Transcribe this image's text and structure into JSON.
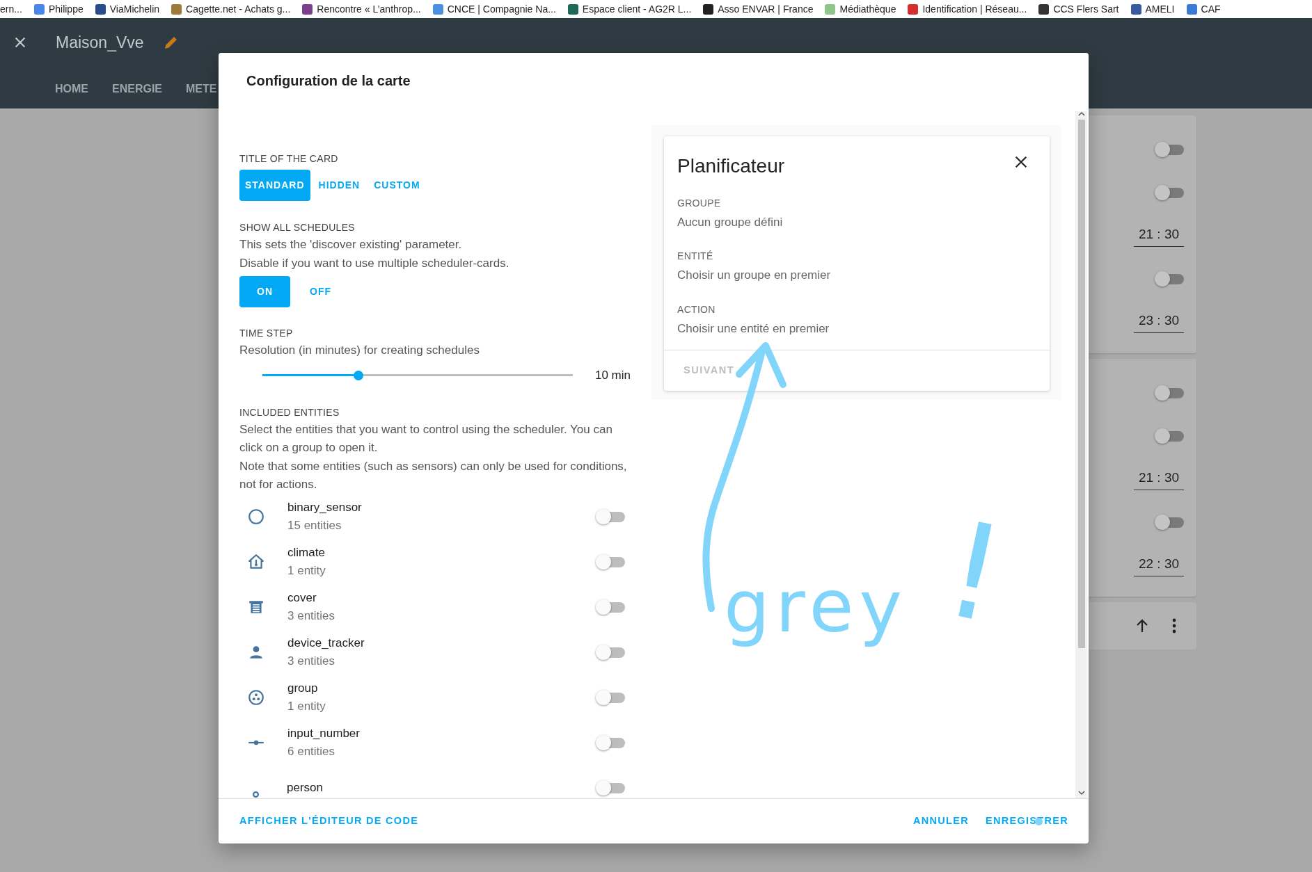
{
  "bookmarks": [
    {
      "label": "ern..."
    },
    {
      "label": "Philippe",
      "color": "#4a86e8"
    },
    {
      "label": "ViaMichelin",
      "color": "#2b4c8c"
    },
    {
      "label": "Cagette.net - Achats g...",
      "color": "#9c7a3c"
    },
    {
      "label": "Rencontre « L’anthrop...",
      "color": "#7b3f8c"
    },
    {
      "label": "CNCE | Compagnie Na...",
      "color": "#4a90e2"
    },
    {
      "label": "Espace client - AG2R L...",
      "color": "#1d6b57"
    },
    {
      "label": "Asso ENVAR | France",
      "color": "#222222"
    },
    {
      "label": "Médiathèque",
      "color": "#8fc48a"
    },
    {
      "label": "Identification | Réseau...",
      "color": "#d32f2f"
    },
    {
      "label": "CCS Flers Sart",
      "color": "#333333"
    },
    {
      "label": "AMELI",
      "color": "#3a5aa0"
    },
    {
      "label": "CAF",
      "color": "#3a7bd5"
    }
  ],
  "header": {
    "title": "Maison_Vve",
    "tabs": [
      "HOME",
      "ENERGIE",
      "METE"
    ]
  },
  "background_cards": [
    {
      "rows": [
        {
          "kind": "toggle",
          "on": false
        },
        {
          "kind": "toggle",
          "on": false
        },
        {
          "kind": "time",
          "value": "21 : 30"
        },
        {
          "kind": "toggle",
          "on": false
        },
        {
          "kind": "time",
          "value": "23 : 30"
        }
      ]
    },
    {
      "rows": [
        {
          "kind": "toggle",
          "on": false
        },
        {
          "kind": "toggle",
          "on": false
        },
        {
          "kind": "time",
          "value": "21 : 30"
        },
        {
          "kind": "toggle",
          "on": false
        },
        {
          "kind": "time",
          "value": "22 : 30"
        }
      ]
    }
  ],
  "dialog": {
    "title": "Configuration de la carte",
    "title_of_card": {
      "label": "TITLE OF THE CARD",
      "options": [
        {
          "label": "STANDARD",
          "selected": true
        },
        {
          "label": "HIDDEN",
          "selected": false
        },
        {
          "label": "CUSTOM",
          "selected": false
        }
      ]
    },
    "show_all": {
      "label": "SHOW ALL SCHEDULES",
      "description": [
        "This sets the 'discover existing' parameter.",
        "Disable if you want to use multiple scheduler-cards."
      ],
      "options": [
        {
          "label": "ON",
          "selected": true
        },
        {
          "label": "OFF",
          "selected": false
        }
      ]
    },
    "time_step": {
      "label": "TIME STEP",
      "description": "Resolution (in minutes) for creating schedules",
      "level": 0.31,
      "reading": "10 min"
    },
    "included": {
      "label": "INCLUDED ENTITIES",
      "description": [
        "Select the entities that you want to control using the scheduler. You can click on a group to open it.",
        "Note that some entities (such as sensors) can only be used for conditions, not for actions."
      ],
      "entities": [
        {
          "name": "binary_sensor",
          "count": "15 entities",
          "on": false
        },
        {
          "name": "climate",
          "count": "1 entity",
          "on": false
        },
        {
          "name": "cover",
          "count": "3 entities",
          "on": false
        },
        {
          "name": "device_tracker",
          "count": "3 entities",
          "on": false
        },
        {
          "name": "group",
          "count": "1 entity",
          "on": false
        },
        {
          "name": "input_number",
          "count": "6 entities",
          "on": false
        },
        {
          "name": "person",
          "on": false
        }
      ]
    },
    "preview": {
      "title": "Planificateur",
      "fields": [
        {
          "label": "GROUPE",
          "value": "Aucun groupe défini"
        },
        {
          "label": "ENTITÉ",
          "value": "Choisir un groupe en premier"
        },
        {
          "label": "ACTION",
          "value": "Choisir une entité en premier"
        }
      ],
      "next_button": {
        "label": "SUIVANT",
        "disabled": true
      }
    },
    "footer": {
      "left": "AFFICHER L'ÉDITEUR DE CODE",
      "buttons": [
        "ANNULER",
        "ENREGISTRER"
      ]
    }
  },
  "annotation": {
    "texts": [
      "grey",
      "!"
    ]
  }
}
